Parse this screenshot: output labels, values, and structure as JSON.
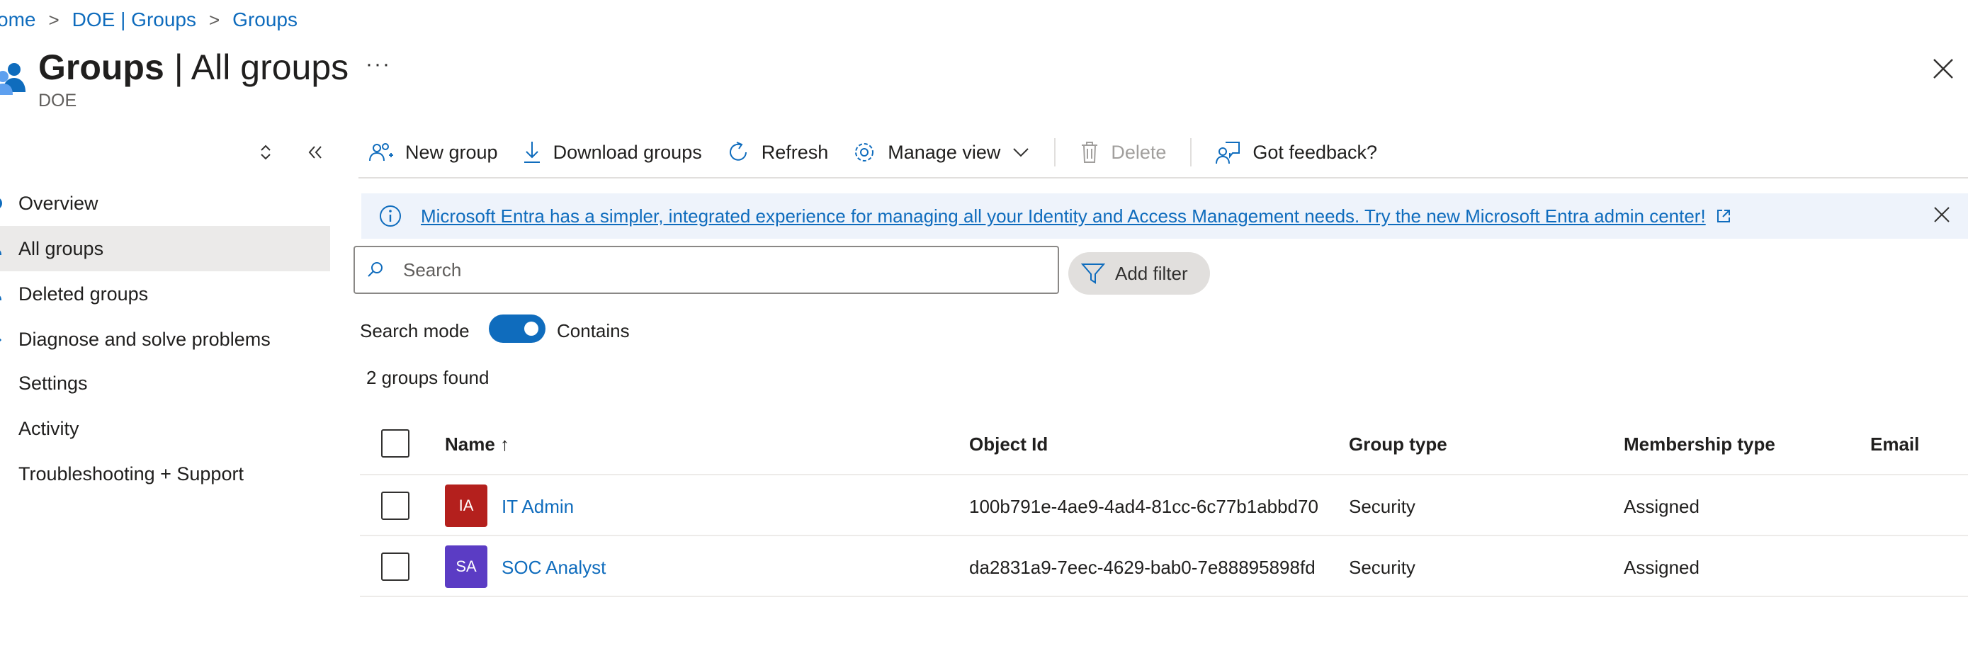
{
  "breadcrumb": {
    "items": [
      "ome",
      "DOE | Groups",
      "Groups"
    ]
  },
  "header": {
    "title_bold": "Groups",
    "title_rest": " | All groups",
    "subtitle": "DOE",
    "more_label": "···",
    "icon": "groups-icon"
  },
  "sidebar": {
    "items": [
      {
        "label": "Overview",
        "icon": "info-icon"
      },
      {
        "label": "All groups",
        "icon": "people-icon",
        "selected": true
      },
      {
        "label": "Deleted groups",
        "icon": "people-icon"
      },
      {
        "label": "Diagnose and solve problems",
        "icon": "wrench-icon"
      },
      {
        "label": "Settings",
        "icon": "gear-icon"
      },
      {
        "label": "Activity",
        "icon": "activity-icon"
      },
      {
        "label": "Troubleshooting + Support",
        "icon": "support-icon"
      }
    ]
  },
  "toolbar": {
    "new_group": "New group",
    "download_groups": "Download groups",
    "refresh": "Refresh",
    "manage_view": "Manage view",
    "delete": "Delete",
    "feedback": "Got feedback?"
  },
  "banner": {
    "message": "Microsoft Entra has a simpler, integrated experience for managing all your Identity and Access Management needs. Try the new Microsoft Entra admin center!"
  },
  "search": {
    "placeholder": "Search",
    "value": "",
    "filter_label": "Add filter",
    "mode_label": "Search mode",
    "mode_value": "Contains",
    "mode_on": true
  },
  "results": {
    "count_text": "2 groups found"
  },
  "table": {
    "columns": [
      "Name ↑",
      "Object Id",
      "Group type",
      "Membership type",
      "Email"
    ],
    "rows": [
      {
        "initials": "IA",
        "avatar_color": "#b4201d",
        "name": "IT Admin",
        "object_id": "100b791e-4ae9-4ad4-81cc-6c77b1abbd70",
        "group_type": "Security",
        "membership_type": "Assigned",
        "email": ""
      },
      {
        "initials": "SA",
        "avatar_color": "#5b3cc4",
        "name": "SOC Analyst",
        "object_id": "da2831a9-7eec-4629-bab0-7e88895898fd",
        "group_type": "Security",
        "membership_type": "Assigned",
        "email": ""
      }
    ]
  },
  "colors": {
    "accent": "#0f6cbd",
    "banner_bg": "#eef3fb",
    "selected_bg": "#ebeae9"
  }
}
